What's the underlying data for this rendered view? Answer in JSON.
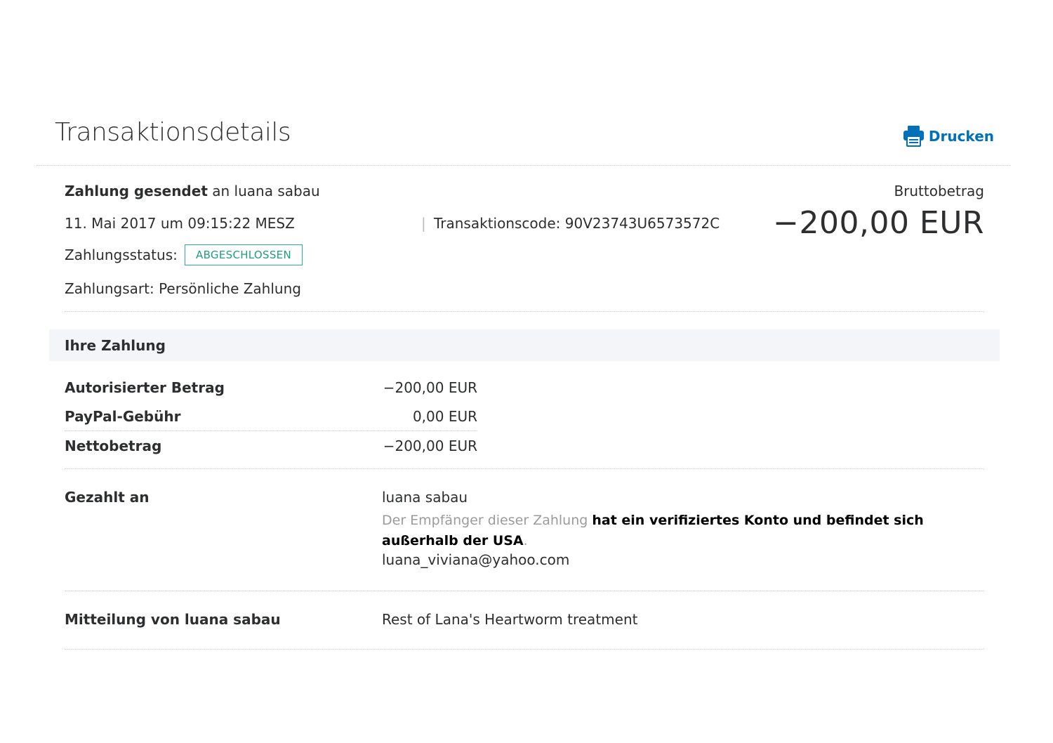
{
  "header": {
    "title": "Transaktionsdetails",
    "print_label": "Drucken"
  },
  "summary": {
    "action_bold": "Zahlung gesendet",
    "action_rest": "an luana sabau",
    "datetime": "11. Mai 2017 um 09:15:22 MESZ",
    "transaction_code": "Transaktionscode: 90V23743U6573572C",
    "status_label": "Zahlungsstatus:",
    "status_value": "ABGESCHLOSSEN",
    "payment_type": "Zahlungsart: Persönliche Zahlung",
    "gross_label": "Bruttobetrag",
    "gross_amount": "−200,00 EUR"
  },
  "your_payment": {
    "title": "Ihre Zahlung",
    "rows": [
      {
        "label": "Autorisierter Betrag",
        "value": "−200,00 EUR"
      },
      {
        "label": "PayPal-Gebühr",
        "value": "0,00 EUR"
      },
      {
        "label": "Nettobetrag",
        "value": "−200,00 EUR"
      }
    ]
  },
  "paid_to": {
    "label": "Gezahlt an",
    "name": "luana sabau",
    "note_gray": "Der Empfänger dieser Zahlung",
    "note_bold": "hat ein verifiziertes Konto und befindet sich außerhalb der USA",
    "note_end": ".",
    "email": "luana_viviana@yahoo.com"
  },
  "message": {
    "label": "Mitteilung von luana sabau",
    "text": "Rest of Lana's Heartworm treatment"
  },
  "colors": {
    "link": "#0070ba",
    "status_border": "#2bb38f",
    "section_bg": "#f3f5f8"
  },
  "icons": {
    "print": "printer-icon"
  }
}
